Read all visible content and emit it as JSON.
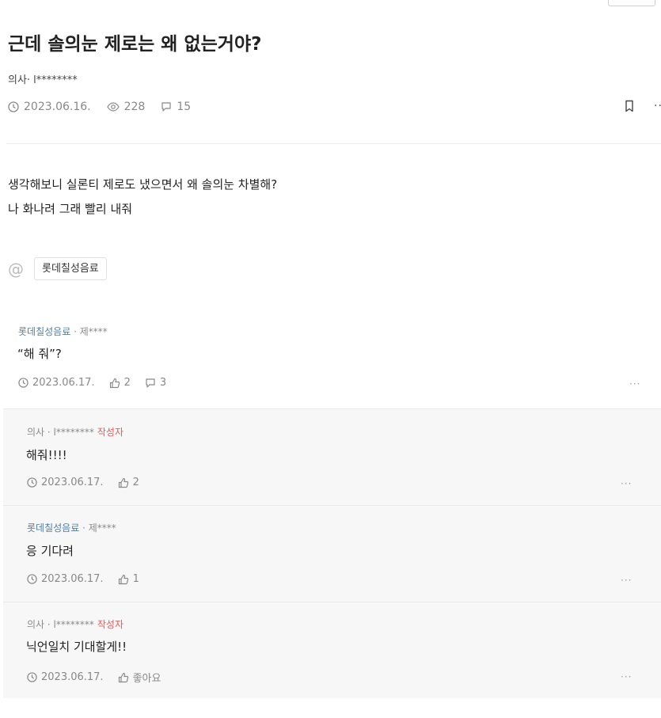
{
  "post": {
    "title": "근데 솔의눈 제로는 왜 없는거야?",
    "author": "의사· l********",
    "date": "2023.06.16.",
    "views": "228",
    "comments": "15",
    "body_lines": [
      "생각해보니 실론티 제로도 냈으면서 왜 솔의눈 차별해?",
      "나 화나려 그래 빨리 내줘"
    ],
    "mention_tag": "롯데칠성음료"
  },
  "comments": [
    {
      "author": "롯데칠성음료",
      "author_rest": " · 제****",
      "op": "",
      "text": "“해 줘”?",
      "date": "2023.06.17.",
      "likes": "2",
      "replies": "3"
    },
    {
      "author": "",
      "author_rest": "의사 · l********",
      "op": "작성자",
      "text": "해줘!!!!",
      "date": "2023.06.17.",
      "likes": "2"
    },
    {
      "author": "롯데칠성음료",
      "author_rest": " · 제****",
      "op": "",
      "text": "응 기다려",
      "date": "2023.06.17.",
      "likes": "1"
    },
    {
      "author": "",
      "author_rest": "의사 · l********",
      "op": "작성자",
      "text": "닉언일치 기대할게!!",
      "date": "2023.06.17.",
      "likes": "좋아요"
    }
  ],
  "icons": {
    "clock": "clock-icon",
    "eye": "eye-icon",
    "comment": "comment-bubble-icon",
    "bookmark": "bookmark-icon",
    "like": "thumbs-up-icon",
    "mention": "at-icon",
    "more": "more-dots-icon"
  },
  "colors": {
    "brand_author": "#4f7fa6",
    "op_badge": "#e35b5b",
    "reply_bg": "#f7f7f7"
  },
  "ui": {
    "more": "···",
    "mention_symbol": "@"
  }
}
